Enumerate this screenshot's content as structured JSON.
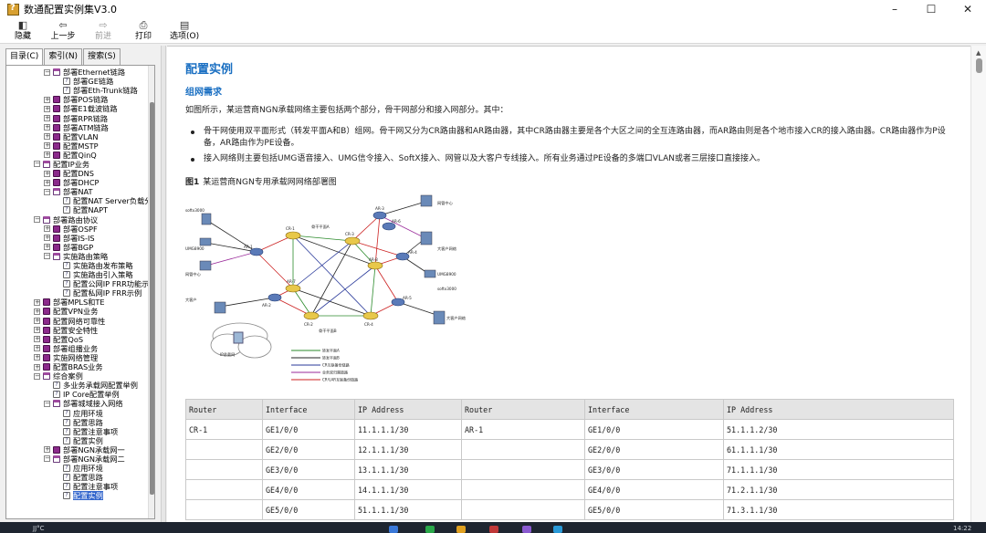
{
  "window": {
    "title": "数通配置实例集V3.0",
    "min": "–",
    "max": "☐",
    "close": "✕"
  },
  "toolbar": [
    {
      "label": "隐藏",
      "icon": "◧",
      "icon_name": "hide-icon",
      "enabled": true
    },
    {
      "label": "上一步",
      "icon": "⇦",
      "icon_name": "back-arrow-icon",
      "enabled": true
    },
    {
      "label": "前进",
      "icon": "⇨",
      "icon_name": "forward-arrow-icon",
      "enabled": false
    },
    {
      "label": "打印",
      "icon": "⎙",
      "icon_name": "print-icon",
      "enabled": true
    },
    {
      "label": "选项(O)",
      "icon": "▤",
      "icon_name": "options-icon",
      "enabled": true
    }
  ],
  "tabs": [
    "目录(C)",
    "索引(N)",
    "搜索(S)"
  ],
  "tree": [
    {
      "d": 1,
      "t": "open",
      "tw": "−",
      "label": "部署Ethernet链路"
    },
    {
      "d": 2,
      "t": "page",
      "label": "部署GE链路"
    },
    {
      "d": 2,
      "t": "page",
      "label": "部署Eth-Trunk链路"
    },
    {
      "d": 1,
      "t": "book",
      "tw": "+",
      "label": "部署POS链路"
    },
    {
      "d": 1,
      "t": "book",
      "tw": "+",
      "label": "部署E1载波链路"
    },
    {
      "d": 1,
      "t": "book",
      "tw": "+",
      "label": "部署RPR链路"
    },
    {
      "d": 1,
      "t": "book",
      "tw": "+",
      "label": "部署ATM链路"
    },
    {
      "d": 1,
      "t": "book",
      "tw": "+",
      "label": "配置VLAN"
    },
    {
      "d": 1,
      "t": "book",
      "tw": "+",
      "label": "配置MSTP"
    },
    {
      "d": 1,
      "t": "book",
      "tw": "+",
      "label": "配置QinQ"
    },
    {
      "d": 0,
      "t": "open",
      "tw": "−",
      "label": "配置IP业务"
    },
    {
      "d": 1,
      "t": "book",
      "tw": "+",
      "label": "配置DNS"
    },
    {
      "d": 1,
      "t": "book",
      "tw": "+",
      "label": "部署DHCP"
    },
    {
      "d": 1,
      "t": "open",
      "tw": "−",
      "label": "部署NAT"
    },
    {
      "d": 2,
      "t": "page",
      "label": "配置NAT Server负载分"
    },
    {
      "d": 2,
      "t": "page",
      "label": "配置NAPT"
    },
    {
      "d": 0,
      "t": "open",
      "tw": "−",
      "label": "部署路由协议"
    },
    {
      "d": 1,
      "t": "book",
      "tw": "+",
      "label": "部署OSPF"
    },
    {
      "d": 1,
      "t": "book",
      "tw": "+",
      "label": "部署IS-IS"
    },
    {
      "d": 1,
      "t": "book",
      "tw": "+",
      "label": "部署BGP"
    },
    {
      "d": 1,
      "t": "open",
      "tw": "−",
      "label": "实施路由策略"
    },
    {
      "d": 2,
      "t": "page",
      "label": "实施路由发布策略"
    },
    {
      "d": 2,
      "t": "page",
      "label": "实施路由引入策略"
    },
    {
      "d": 2,
      "t": "page",
      "label": "配置公网IP FRR功能示"
    },
    {
      "d": 2,
      "t": "page",
      "label": "配置私网IP FRR示例"
    },
    {
      "d": 0,
      "t": "book",
      "tw": "+",
      "label": "部署MPLS和TE"
    },
    {
      "d": 0,
      "t": "book",
      "tw": "+",
      "label": "配置VPN业务"
    },
    {
      "d": 0,
      "t": "book",
      "tw": "+",
      "label": "配置网络可靠性"
    },
    {
      "d": 0,
      "t": "book",
      "tw": "+",
      "label": "配置安全特性"
    },
    {
      "d": 0,
      "t": "book",
      "tw": "+",
      "label": "配置QoS"
    },
    {
      "d": 0,
      "t": "book",
      "tw": "+",
      "label": "部署组播业务"
    },
    {
      "d": 0,
      "t": "book",
      "tw": "+",
      "label": "实施网络管理"
    },
    {
      "d": 0,
      "t": "book",
      "tw": "+",
      "label": "配置BRAS业务"
    },
    {
      "d": 0,
      "t": "open",
      "tw": "−",
      "label": "综合案例"
    },
    {
      "d": 1,
      "t": "page",
      "label": "多业务承载网配置举例"
    },
    {
      "d": 1,
      "t": "page",
      "label": "IP Core配置举例"
    },
    {
      "d": 1,
      "t": "open",
      "tw": "−",
      "label": "部署城域接入网络"
    },
    {
      "d": 2,
      "t": "page",
      "label": "应用环境"
    },
    {
      "d": 2,
      "t": "page",
      "label": "配置思路"
    },
    {
      "d": 2,
      "t": "page",
      "label": "配置注意事项"
    },
    {
      "d": 2,
      "t": "page",
      "label": "配置实例"
    },
    {
      "d": 1,
      "t": "book",
      "tw": "+",
      "label": "部署NGN承载网一"
    },
    {
      "d": 1,
      "t": "open",
      "tw": "−",
      "label": "部署NGN承载网二"
    },
    {
      "d": 2,
      "t": "page",
      "label": "应用环境"
    },
    {
      "d": 2,
      "t": "page",
      "label": "配置思路"
    },
    {
      "d": 2,
      "t": "page",
      "label": "配置注意事项"
    },
    {
      "d": 2,
      "t": "page",
      "label": "配置实例",
      "selected": true
    }
  ],
  "content": {
    "title": "配置实例",
    "section": "组网需求",
    "intro": "如图所示，某运营商NGN承载网络主要包括两个部分，骨干网部分和接入网部分。其中：",
    "bullets": [
      "骨干网使用双平面形式（转发平面A和B）组网。骨干网又分为CR路由器和AR路由器，其中CR路由器主要是各个大区之间的全互连路由器，而AR路由则是各个地市接入CR的接入路由器。CR路由器作为P设备，AR路由作为PE设备。",
      "接入网络则主要包括UMG语音接入、UMG信令接入、SoftX接入、网管以及大客户专线接入。所有业务通过PE设备的多端口VLAN或者三层接口直接接入。"
    ],
    "figure_no": "图1",
    "figure_caption": "某运营商NGN专用承载网网络部署图"
  },
  "diagram": {
    "nodes": [
      "CR-1",
      "CR-2",
      "CR-3",
      "CR-4",
      "AR-1",
      "AR-2",
      "AR-3",
      "AR-4",
      "AR-5",
      "AR-6",
      "AR-7",
      "AR-8"
    ],
    "legend": [
      "转发平面A",
      "转发平面B",
      "CR互联备份链路",
      "业务双归属链路",
      "CR与AR互联备份链路"
    ],
    "labels": [
      "softx3000",
      "UMG8900",
      "网管中心",
      "大客户",
      "IP承载网",
      "大客户网络",
      "UMG8900",
      "softx3000",
      "网管中心",
      "大客户网络",
      "骨干平面A",
      "骨干平面B"
    ]
  },
  "table": {
    "headers": [
      "Router",
      "Interface",
      "IP Address",
      "Router",
      "Interface",
      "IP Address"
    ],
    "rows": [
      [
        "CR-1",
        "GE1/0/0",
        "11.1.1.1/30",
        "AR-1",
        "GE1/0/0",
        "51.1.1.2/30"
      ],
      [
        "",
        "GE2/0/0",
        "12.1.1.1/30",
        "",
        "GE2/0/0",
        "61.1.1.1/30"
      ],
      [
        "",
        "GE3/0/0",
        "13.1.1.1/30",
        "",
        "GE3/0/0",
        "71.1.1.1/30"
      ],
      [
        "",
        "GE4/0/0",
        "14.1.1.1/30",
        "",
        "GE4/0/0",
        "71.2.1.1/30"
      ],
      [
        "",
        "GE5/0/0",
        "51.1.1.1/30",
        "",
        "GE5/0/0",
        "71.3.1.1/30"
      ]
    ]
  },
  "taskbar": {
    "left_text": "JJ°C",
    "time": "14:22"
  }
}
